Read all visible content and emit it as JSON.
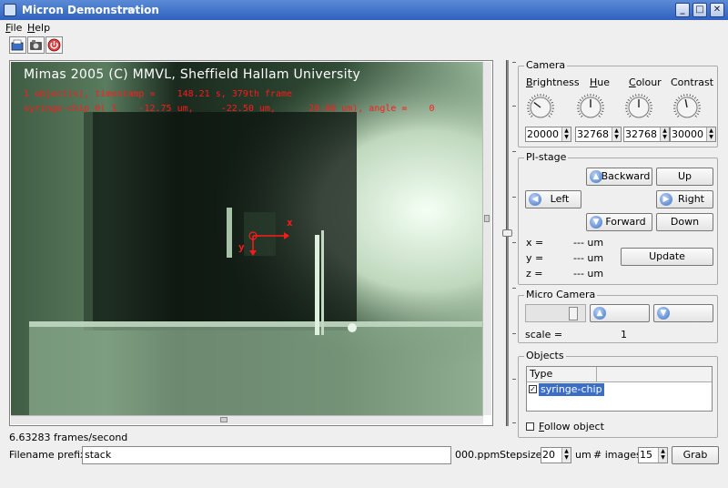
{
  "window": {
    "title": "Micron Demonstration"
  },
  "menu": [
    {
      "label": "File",
      "u": "F",
      "rest": "ile"
    },
    {
      "label": "Help",
      "u": "H",
      "rest": "elp"
    }
  ],
  "toolbar": {
    "icons": [
      "open-icon",
      "camera-icon",
      "power-icon"
    ]
  },
  "video": {
    "header": "Mimas 2005 (C) MMVL, Sheffield Hallam University",
    "line1": "1 object(s), timestamp =    148.21 s, 379th frame",
    "line2": "syringe-chip 0( 1    -12.75 um,     -22.50 um,      20.00 um), angle =    0",
    "axis_x": "x",
    "axis_y": "y",
    "overlay_color": "#ff1a1a"
  },
  "camera": {
    "legend": "Camera",
    "controls": [
      {
        "label": "Brightness",
        "u": "B",
        "rest": "rightness",
        "value": "20000",
        "level": 0.305
      },
      {
        "label": "Hue",
        "u": "H",
        "rest": "ue",
        "value": "32768",
        "level": 0.5
      },
      {
        "label": "Colour",
        "u": "C",
        "rest": "olour",
        "value": "32768",
        "level": 0.5
      },
      {
        "label": "Contrast",
        "u": "",
        "rest": "Contrast",
        "value": "30000",
        "level": 0.458
      }
    ]
  },
  "pistage": {
    "legend": "PI-stage",
    "backward": "Backward",
    "up": "Up",
    "left": "Left",
    "right": "Right",
    "forward": "Forward",
    "down": "Down",
    "x_label": "x =",
    "y_label": "y =",
    "z_label": "z =",
    "x_value": "--- um",
    "y_value": "--- um",
    "z_value": "--- um",
    "update": "Update"
  },
  "micro": {
    "legend": "Micro Camera",
    "scale_label": "scale =",
    "scale_value": "1"
  },
  "objects": {
    "legend": "Objects",
    "col_type": "Type",
    "rows": [
      {
        "name": "syringe-chip",
        "checked": true
      }
    ],
    "follow": "Follow object",
    "follow_u": "F",
    "follow_rest": "ollow object"
  },
  "status": "6.63283 frames/second",
  "bottom": {
    "filename_label": "Filename prefix",
    "filename_value": "stack",
    "suffix": "000.ppm",
    "stepsize_label": "Stepsize",
    "stepsize_value": "20",
    "units": "um",
    "images_label": "# images",
    "images_value": "15",
    "grab": "Grab"
  }
}
